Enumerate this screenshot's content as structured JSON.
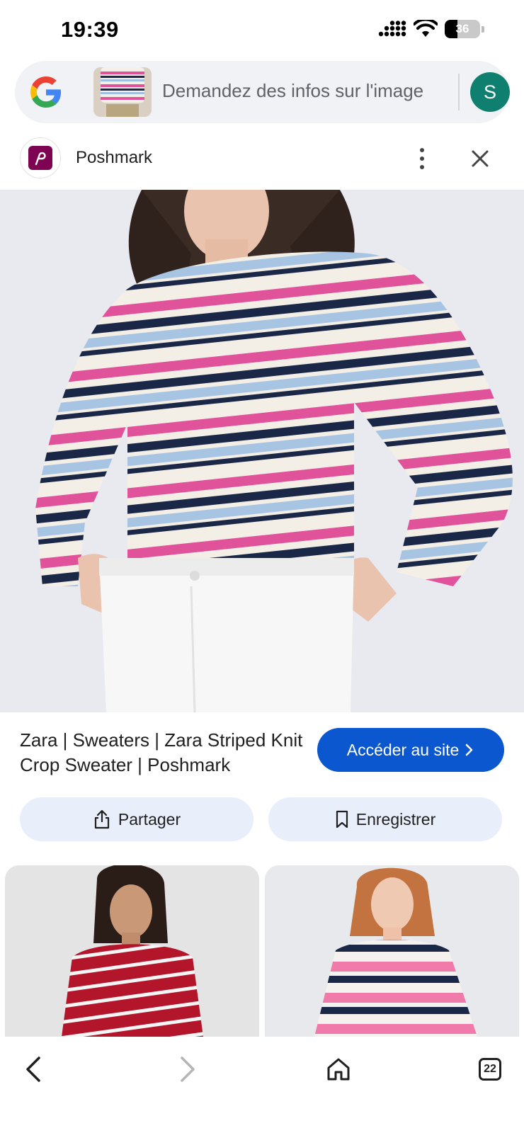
{
  "status_bar": {
    "time": "19:39",
    "battery_level": "36",
    "icons": [
      "signal-icon",
      "wifi-icon",
      "battery-icon"
    ]
  },
  "search": {
    "placeholder": "Demandez des infos sur l'image",
    "avatar_letter": "S"
  },
  "source": {
    "name": "Poshmark"
  },
  "result": {
    "title": "Zara | Sweaters | Zara Striped Knit Crop Sweater | Poshmark",
    "visit_label": "Accéder au site",
    "share_label": "Partager",
    "save_label": "Enregistrer"
  },
  "bottom_nav": {
    "tabs_count": "22"
  },
  "colors": {
    "accent": "#0b57d0",
    "avatar": "#0f7f6f",
    "poshmark": "#7f0353",
    "button_tint": "#e8effb"
  }
}
